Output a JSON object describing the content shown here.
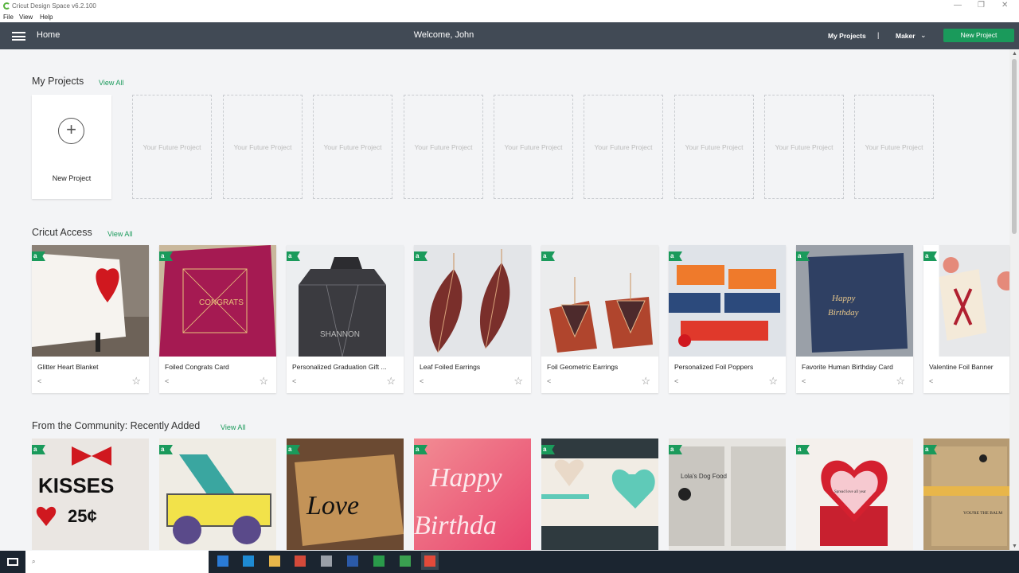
{
  "window": {
    "title": "Cricut Design Space  v6.2.100"
  },
  "menu": [
    "File",
    "View",
    "Help"
  ],
  "appbar": {
    "home": "Home",
    "welcome": "Welcome, John",
    "my_projects": "My Projects",
    "separator": "|",
    "machine": "Maker",
    "new_project": "New Project"
  },
  "my_projects": {
    "title": "My Projects",
    "view_all": "View All",
    "new_label": "New Project",
    "placeholders": [
      "Your Future Project",
      "Your Future Project",
      "Your Future Project",
      "Your Future Project",
      "Your Future Project",
      "Your Future Project",
      "Your Future Project",
      "Your Future Project",
      "Your Future Project"
    ]
  },
  "access": {
    "title": "Cricut Access",
    "view_all": "View All",
    "badge": "a",
    "items": [
      "Glitter Heart Blanket",
      "Foiled Congrats Card",
      "Personalized Graduation Gift ...",
      "Leaf Foiled Earrings",
      "Foil Geometric Earrings",
      "Personalized Foil Poppers",
      "Favorite Human Birthday Card",
      "Valentine Foil Banner"
    ]
  },
  "community": {
    "title": "From the Community: Recently Added",
    "view_all": "View All",
    "badge": "a",
    "texts": [
      "KISSES",
      "25¢",
      "Love",
      "Happy",
      "Birthda",
      "Lola's Dog Food",
      "Spread love all year",
      "YOU'RE THE BALM"
    ]
  },
  "colors": {
    "accent": "#1a9a5b",
    "header": "#414a55"
  }
}
